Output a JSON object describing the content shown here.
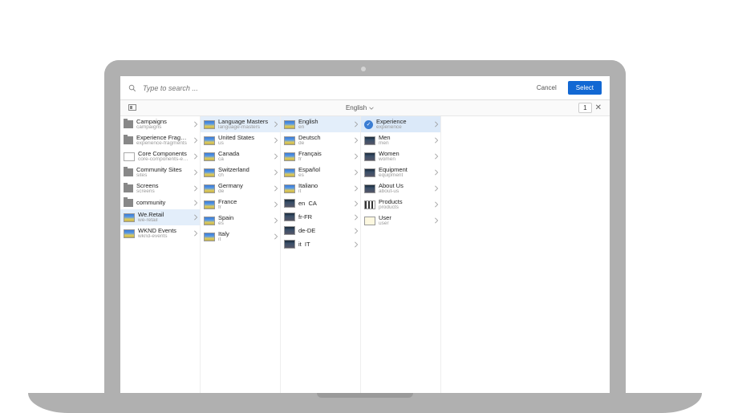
{
  "search": {
    "placeholder": "Type to search ..."
  },
  "actions": {
    "cancel": "Cancel",
    "select": "Select"
  },
  "filter": {
    "label": "English",
    "count": "1"
  },
  "columns": [
    {
      "items": [
        {
          "title": "Campaigns",
          "subtitle": "campaigns",
          "thumb": "folder",
          "chevron": true
        },
        {
          "title": "Experience Fragments",
          "subtitle": "experience-fragments",
          "thumb": "folder",
          "chevron": true
        },
        {
          "title": "Core Components",
          "subtitle": "core-components-exa...",
          "thumb": "outlined",
          "chevron": true
        },
        {
          "title": "Community Sites",
          "subtitle": "sites",
          "thumb": "folder",
          "chevron": true
        },
        {
          "title": "Screens",
          "subtitle": "screens",
          "thumb": "folder",
          "chevron": true
        },
        {
          "title": "community",
          "subtitle": "",
          "thumb": "folder",
          "chevron": true
        },
        {
          "title": "We.Retail",
          "subtitle": "we-retail",
          "thumb": "scenic",
          "chevron": true,
          "selected": true
        },
        {
          "title": "WKND Events",
          "subtitle": "wknd-events",
          "thumb": "scenic",
          "chevron": true
        }
      ]
    },
    {
      "items": [
        {
          "title": "Language Masters",
          "subtitle": "language-masters",
          "thumb": "scenic",
          "chevron": true,
          "selected": true
        },
        {
          "title": "United States",
          "subtitle": "us",
          "thumb": "scenic",
          "chevron": true
        },
        {
          "title": "Canada",
          "subtitle": "ca",
          "thumb": "scenic",
          "chevron": true
        },
        {
          "title": "Switzerland",
          "subtitle": "ch",
          "thumb": "scenic",
          "chevron": true
        },
        {
          "title": "Germany",
          "subtitle": "de",
          "thumb": "scenic",
          "chevron": true
        },
        {
          "title": "France",
          "subtitle": "fr",
          "thumb": "scenic",
          "chevron": true
        },
        {
          "title": "Spain",
          "subtitle": "es",
          "thumb": "scenic",
          "chevron": true
        },
        {
          "title": "Italy",
          "subtitle": "it",
          "thumb": "scenic",
          "chevron": true
        }
      ]
    },
    {
      "items": [
        {
          "title": "English",
          "subtitle": "en",
          "thumb": "scenic",
          "chevron": true,
          "selected": true
        },
        {
          "title": "Deutsch",
          "subtitle": "de",
          "thumb": "scenic",
          "chevron": true
        },
        {
          "title": "Français",
          "subtitle": "fr",
          "thumb": "scenic",
          "chevron": true
        },
        {
          "title": "Español",
          "subtitle": "es",
          "thumb": "scenic",
          "chevron": true
        },
        {
          "title": "Italiano",
          "subtitle": "it",
          "thumb": "scenic",
          "chevron": true
        },
        {
          "title": "en_CA",
          "subtitle": "",
          "thumb": "dark",
          "chevron": true
        },
        {
          "title": "fr-FR",
          "subtitle": "",
          "thumb": "dark",
          "chevron": true
        },
        {
          "title": "de-DE",
          "subtitle": "",
          "thumb": "dark",
          "chevron": true
        },
        {
          "title": "it_IT",
          "subtitle": "",
          "thumb": "dark",
          "chevron": true
        }
      ]
    },
    {
      "items": [
        {
          "title": "Experience",
          "subtitle": "experience",
          "thumb": "scenic",
          "chevron": true,
          "picked": true,
          "check": true
        },
        {
          "title": "Men",
          "subtitle": "men",
          "thumb": "dark",
          "chevron": true
        },
        {
          "title": "Women",
          "subtitle": "women",
          "thumb": "dark",
          "chevron": true
        },
        {
          "title": "Equipment",
          "subtitle": "equipment",
          "thumb": "dark",
          "chevron": true
        },
        {
          "title": "About Us",
          "subtitle": "about-us",
          "thumb": "dark",
          "chevron": true
        },
        {
          "title": "Products",
          "subtitle": "products",
          "thumb": "prod",
          "chevron": true
        },
        {
          "title": "User",
          "subtitle": "user",
          "thumb": "user",
          "chevron": true
        }
      ]
    }
  ]
}
